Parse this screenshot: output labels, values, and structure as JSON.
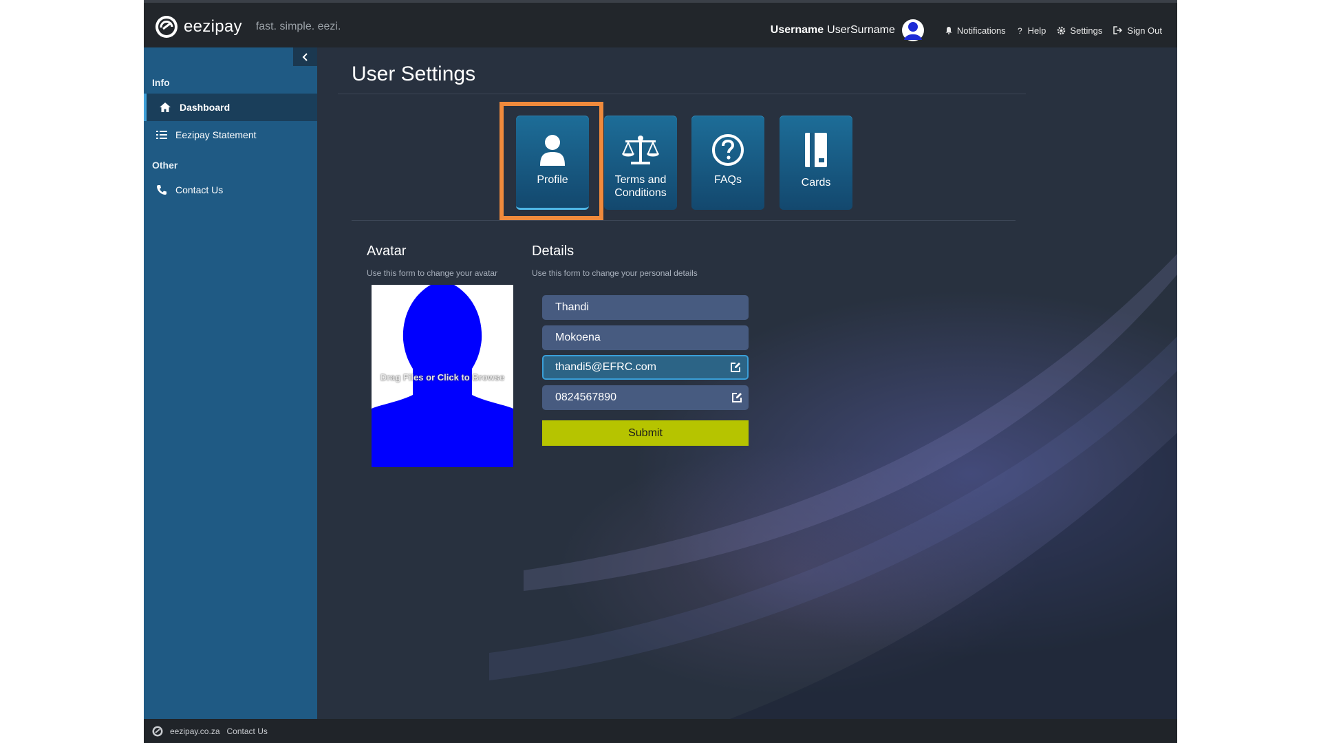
{
  "topbar": {
    "brand": "eezipay",
    "tagline": "fast. simple. eezi.",
    "username_bold": "Username",
    "username": "UserSurname",
    "links": [
      {
        "label": "Notifications",
        "icon": "bell-icon"
      },
      {
        "label": "Help",
        "icon": "question-icon"
      },
      {
        "label": "Settings",
        "icon": "gear-icon"
      },
      {
        "label": "Sign Out",
        "icon": "sign-out-icon"
      }
    ]
  },
  "sidebar": {
    "groups": [
      {
        "title": "Info",
        "items": [
          {
            "label": "Dashboard",
            "icon": "home-icon",
            "active": true
          },
          {
            "label": "Eezipay Statement",
            "icon": "list-icon",
            "active": false
          }
        ]
      },
      {
        "title": "Other",
        "items": [
          {
            "label": "Contact Us",
            "icon": "phone-icon",
            "active": false
          }
        ]
      }
    ]
  },
  "main": {
    "title": "User Settings",
    "tiles": [
      {
        "label": "Profile",
        "icon": "user-icon",
        "active": true
      },
      {
        "label": "Terms and Conditions",
        "icon": "scales-icon",
        "active": false
      },
      {
        "label": "FAQs",
        "icon": "question-circle-icon",
        "active": false
      },
      {
        "label": "Cards",
        "icon": "card-icon",
        "active": false
      }
    ],
    "avatar": {
      "title": "Avatar",
      "subtitle": "Use this form to change your avatar",
      "drop_text": "Drag Files or Click to Browse"
    },
    "details": {
      "title": "Details",
      "subtitle": "Use this form to change your personal details",
      "first_name": "Thandi",
      "last_name": "Mokoena",
      "email": "thandi5@EFRC.com",
      "phone": "0824567890",
      "submit_label": "Submit"
    }
  },
  "footer": {
    "site": "eezipay.co.za",
    "contact": "Contact Us"
  },
  "colors": {
    "accent_highlight": "#f08a3c",
    "submit": "#b6c400",
    "sidebar": "#1f5a84",
    "tile": "#1a5b84"
  }
}
